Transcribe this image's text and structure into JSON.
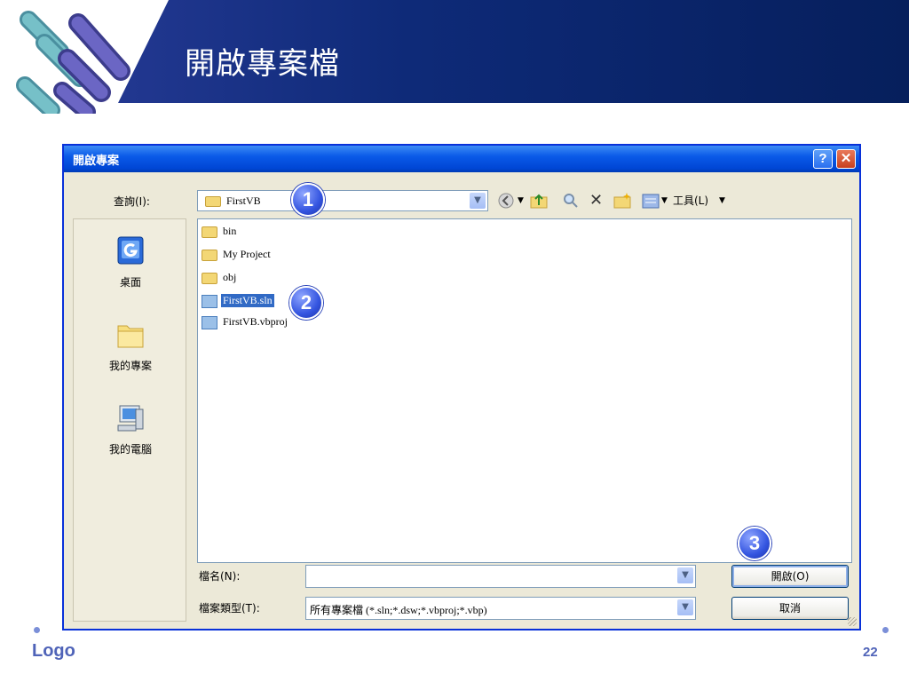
{
  "slide": {
    "title": "開啟專案檔",
    "footer_logo": "Logo",
    "page_number": "22"
  },
  "dialog": {
    "title": "開啟專案",
    "help_label": "?",
    "close_label": "✕",
    "look_in_label": "查詢(I):",
    "look_in_value": "FirstVB",
    "tools_label": "工具(L)",
    "places": [
      {
        "label": "桌面",
        "icon": "desktop-icon"
      },
      {
        "label": "我的專案",
        "icon": "folder-icon"
      },
      {
        "label": "我的電腦",
        "icon": "computer-icon"
      }
    ],
    "files": [
      {
        "name": "bin",
        "type": "folder",
        "selected": false
      },
      {
        "name": "My Project",
        "type": "folder",
        "selected": false
      },
      {
        "name": "obj",
        "type": "folder",
        "selected": false
      },
      {
        "name": "FirstVB.sln",
        "type": "solution",
        "selected": true
      },
      {
        "name": "FirstVB.vbproj",
        "type": "project",
        "selected": false
      }
    ],
    "filename_label": "檔名(N):",
    "filename_value": "",
    "filetype_label": "檔案類型(T):",
    "filetype_value": "所有專案檔 (*.sln;*.dsw;*.vbproj;*.vbp)",
    "open_button": "開啟(O)",
    "cancel_button": "取消"
  },
  "annotations": [
    "1",
    "2",
    "3"
  ],
  "colors": {
    "header_bg": "#0e2a78",
    "titlebar": "#0a5ae8",
    "selection": "#316ac5",
    "badge": "#3455e0",
    "footer_text": "#4f63b8"
  }
}
